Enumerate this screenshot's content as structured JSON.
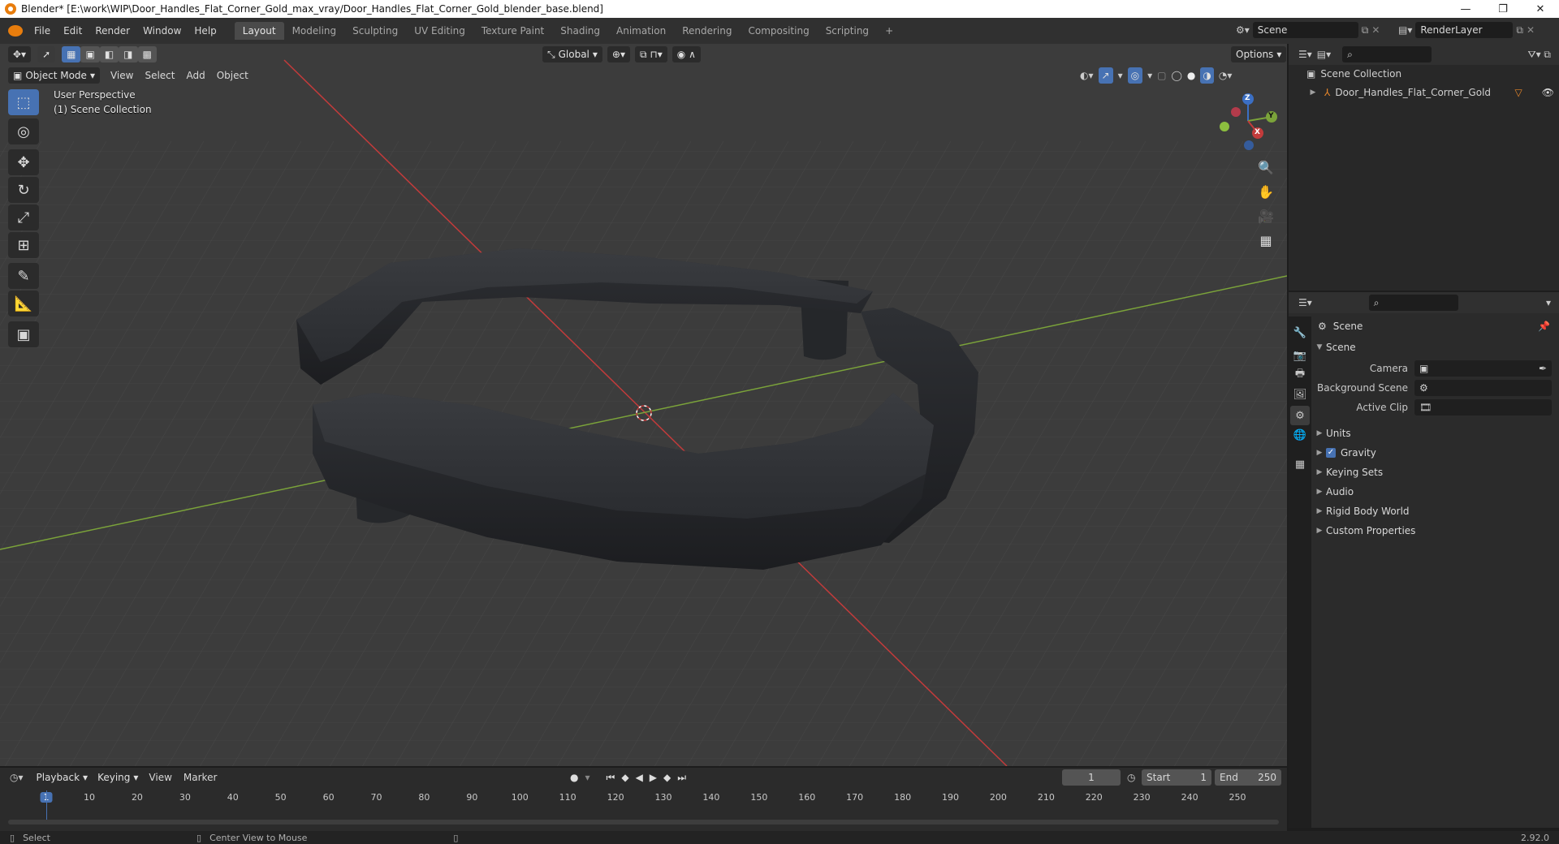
{
  "window": {
    "title": "Blender* [E:\\work\\WIP\\Door_Handles_Flat_Corner_Gold_max_vray/Door_Handles_Flat_Corner_Gold_blender_base.blend]",
    "minimize": "—",
    "restore": "❐",
    "close": "✕"
  },
  "menu": {
    "file": "File",
    "edit": "Edit",
    "render": "Render",
    "window": "Window",
    "help": "Help"
  },
  "workspaces": [
    "Layout",
    "Modeling",
    "Sculpting",
    "UV Editing",
    "Texture Paint",
    "Shading",
    "Animation",
    "Rendering",
    "Compositing",
    "Scripting"
  ],
  "active_workspace": "Layout",
  "scene_selector": {
    "value": "Scene"
  },
  "view_layer": {
    "value": "RenderLayer"
  },
  "viewport": {
    "transform_orientation": "Global",
    "options_label": "Options",
    "mode": "Object Mode",
    "menus": {
      "view": "View",
      "select": "Select",
      "add": "Add",
      "object": "Object"
    },
    "perspective_label": "User Perspective",
    "collection_label": "(1) Scene Collection",
    "gizmo": {
      "x": "X",
      "y": "Y",
      "z": "Z"
    }
  },
  "outliner": {
    "root": "Scene Collection",
    "items": [
      {
        "label": "Door_Handles_Flat_Corner_Gold"
      }
    ]
  },
  "properties": {
    "context_label": "Scene",
    "section": "Scene",
    "fields": {
      "camera": "Camera",
      "background_scene": "Background Scene",
      "active_clip": "Active Clip"
    },
    "panels": {
      "units": "Units",
      "gravity": "Gravity",
      "keying_sets": "Keying Sets",
      "audio": "Audio",
      "rigid_body_world": "Rigid Body World",
      "custom_properties": "Custom Properties"
    },
    "gravity_checked": true
  },
  "timeline": {
    "menus": {
      "playback": "Playback",
      "keying": "Keying",
      "view": "View",
      "marker": "Marker"
    },
    "current_frame": "1",
    "start_label": "Start",
    "start_value": "1",
    "end_label": "End",
    "end_value": "250",
    "ticks": [
      "1",
      "10",
      "20",
      "30",
      "40",
      "50",
      "60",
      "70",
      "80",
      "90",
      "100",
      "110",
      "120",
      "130",
      "140",
      "150",
      "160",
      "170",
      "180",
      "190",
      "200",
      "210",
      "220",
      "230",
      "240",
      "250"
    ]
  },
  "status": {
    "select": "Select",
    "center_view": "Center View to Mouse",
    "version": "2.92.0"
  },
  "colors": {
    "accent": "#4772b3",
    "x_axis": "#c33b3b",
    "y_axis": "#7ba33a",
    "z_axis": "#3b6fc4",
    "object": "#e8872a"
  }
}
